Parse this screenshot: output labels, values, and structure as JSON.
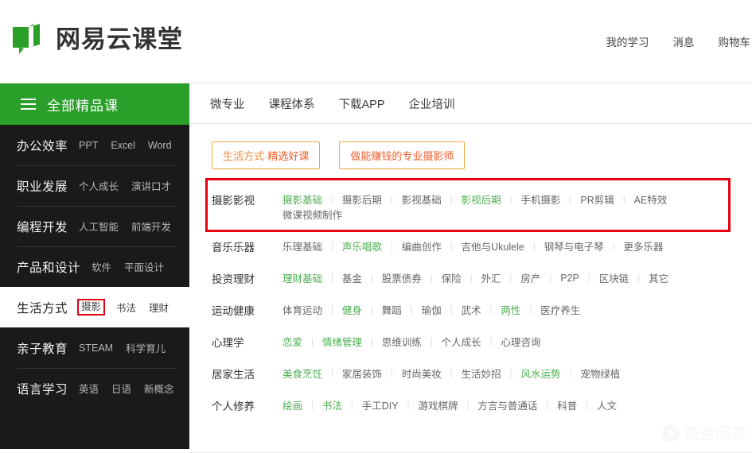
{
  "header": {
    "brand_title": "网易云课堂",
    "logo_icon": "book-logo-icon",
    "nav": [
      {
        "label": "我的学习",
        "name": "my-learning"
      },
      {
        "label": "消息",
        "name": "messages"
      },
      {
        "label": "购物车",
        "name": "shopping-cart"
      }
    ]
  },
  "sidebar": {
    "header_label": "全部精品课",
    "menu_icon": "hamburger-icon",
    "items": [
      {
        "main": "办公效率",
        "subs": [
          "PPT",
          "Excel",
          "Word"
        ],
        "active": false
      },
      {
        "main": "职业发展",
        "subs": [
          "个人成长",
          "演讲口才"
        ],
        "active": false
      },
      {
        "main": "编程开发",
        "subs": [
          "人工智能",
          "前端开发"
        ],
        "active": false
      },
      {
        "main": "产品和设计",
        "subs": [
          "软件",
          "平面设计"
        ],
        "active": false
      },
      {
        "main": "生活方式",
        "subs": [
          "摄影",
          "书法",
          "理财"
        ],
        "active": true,
        "boxed_sub": "摄影"
      },
      {
        "main": "亲子教育",
        "subs": [
          "STEAM",
          "科学育儿"
        ],
        "active": false
      },
      {
        "main": "语言学习",
        "subs": [
          "英语",
          "日语",
          "新概念"
        ],
        "active": false
      }
    ]
  },
  "main": {
    "nav": [
      {
        "label": "微专业",
        "name": "micro-major"
      },
      {
        "label": "课程体系",
        "name": "course-system"
      },
      {
        "label": "下载APP",
        "name": "download-app"
      },
      {
        "label": "企业培训",
        "name": "enterprise-training"
      }
    ],
    "promos": [
      {
        "prefix": "生活方式·",
        "accent": "精选好课",
        "name": "lifestyle-featured-courses"
      },
      {
        "prefix": "",
        "accent": "做能赚钱的专业摄影师",
        "name": "pro-photographer-promo"
      }
    ],
    "categories": [
      {
        "title": "摄影影视",
        "highlighted": true,
        "links": [
          {
            "label": "摄影基础",
            "green": true
          },
          {
            "label": "摄影后期",
            "green": false
          },
          {
            "label": "影视基础",
            "green": false
          },
          {
            "label": "影视后期",
            "green": true
          },
          {
            "label": "手机摄影",
            "green": false
          },
          {
            "label": "PR剪辑",
            "green": false
          },
          {
            "label": "AE特效",
            "green": false
          },
          {
            "label": "微课视频制作",
            "green": false,
            "newline": true
          }
        ]
      },
      {
        "title": "音乐乐器",
        "highlighted": false,
        "links": [
          {
            "label": "乐理基础",
            "green": false
          },
          {
            "label": "声乐唱歌",
            "green": true
          },
          {
            "label": "编曲创作",
            "green": false
          },
          {
            "label": "吉他与Ukulele",
            "green": false
          },
          {
            "label": "钢琴与电子琴",
            "green": false
          },
          {
            "label": "更多乐器",
            "green": false
          }
        ]
      },
      {
        "title": "投资理财",
        "highlighted": false,
        "links": [
          {
            "label": "理财基础",
            "green": true
          },
          {
            "label": "基金",
            "green": false
          },
          {
            "label": "股票债券",
            "green": false
          },
          {
            "label": "保险",
            "green": false
          },
          {
            "label": "外汇",
            "green": false
          },
          {
            "label": "房产",
            "green": false
          },
          {
            "label": "P2P",
            "green": false
          },
          {
            "label": "区块链",
            "green": false
          },
          {
            "label": "其它",
            "green": false
          }
        ]
      },
      {
        "title": "运动健康",
        "highlighted": false,
        "links": [
          {
            "label": "体育运动",
            "green": false
          },
          {
            "label": "健身",
            "green": true
          },
          {
            "label": "舞蹈",
            "green": false
          },
          {
            "label": "瑜伽",
            "green": false
          },
          {
            "label": "武术",
            "green": false
          },
          {
            "label": "两性",
            "green": true
          },
          {
            "label": "医疗养生",
            "green": false
          }
        ]
      },
      {
        "title": "心理学",
        "highlighted": false,
        "links": [
          {
            "label": "恋爱",
            "green": true
          },
          {
            "label": "情绪管理",
            "green": true
          },
          {
            "label": "思维训练",
            "green": false
          },
          {
            "label": "个人成长",
            "green": false
          },
          {
            "label": "心理咨询",
            "green": false
          }
        ]
      },
      {
        "title": "居家生活",
        "highlighted": false,
        "links": [
          {
            "label": "美食烹饪",
            "green": true
          },
          {
            "label": "家居装饰",
            "green": false
          },
          {
            "label": "时尚美妆",
            "green": false
          },
          {
            "label": "生活妙招",
            "green": false
          },
          {
            "label": "风水运势",
            "green": true
          },
          {
            "label": "宠物绿植",
            "green": false
          }
        ]
      },
      {
        "title": "个人修养",
        "highlighted": false,
        "links": [
          {
            "label": "绘画",
            "green": true
          },
          {
            "label": "书法",
            "green": true
          },
          {
            "label": "手工DIY",
            "green": false
          },
          {
            "label": "游戏棋牌",
            "green": false
          },
          {
            "label": "方言与普通话",
            "green": false
          },
          {
            "label": "科普",
            "green": false
          },
          {
            "label": "人文",
            "green": false
          }
        ]
      }
    ]
  },
  "watermark": {
    "text": "语空问答",
    "icon": "wukong-logo-icon"
  },
  "colors": {
    "brand_green": "#2aa02a",
    "link_green": "#4caf50",
    "highlight_red": "#e60012",
    "promo_orange": "#f0a73a",
    "sidebar_bg": "#1a1a1a"
  }
}
